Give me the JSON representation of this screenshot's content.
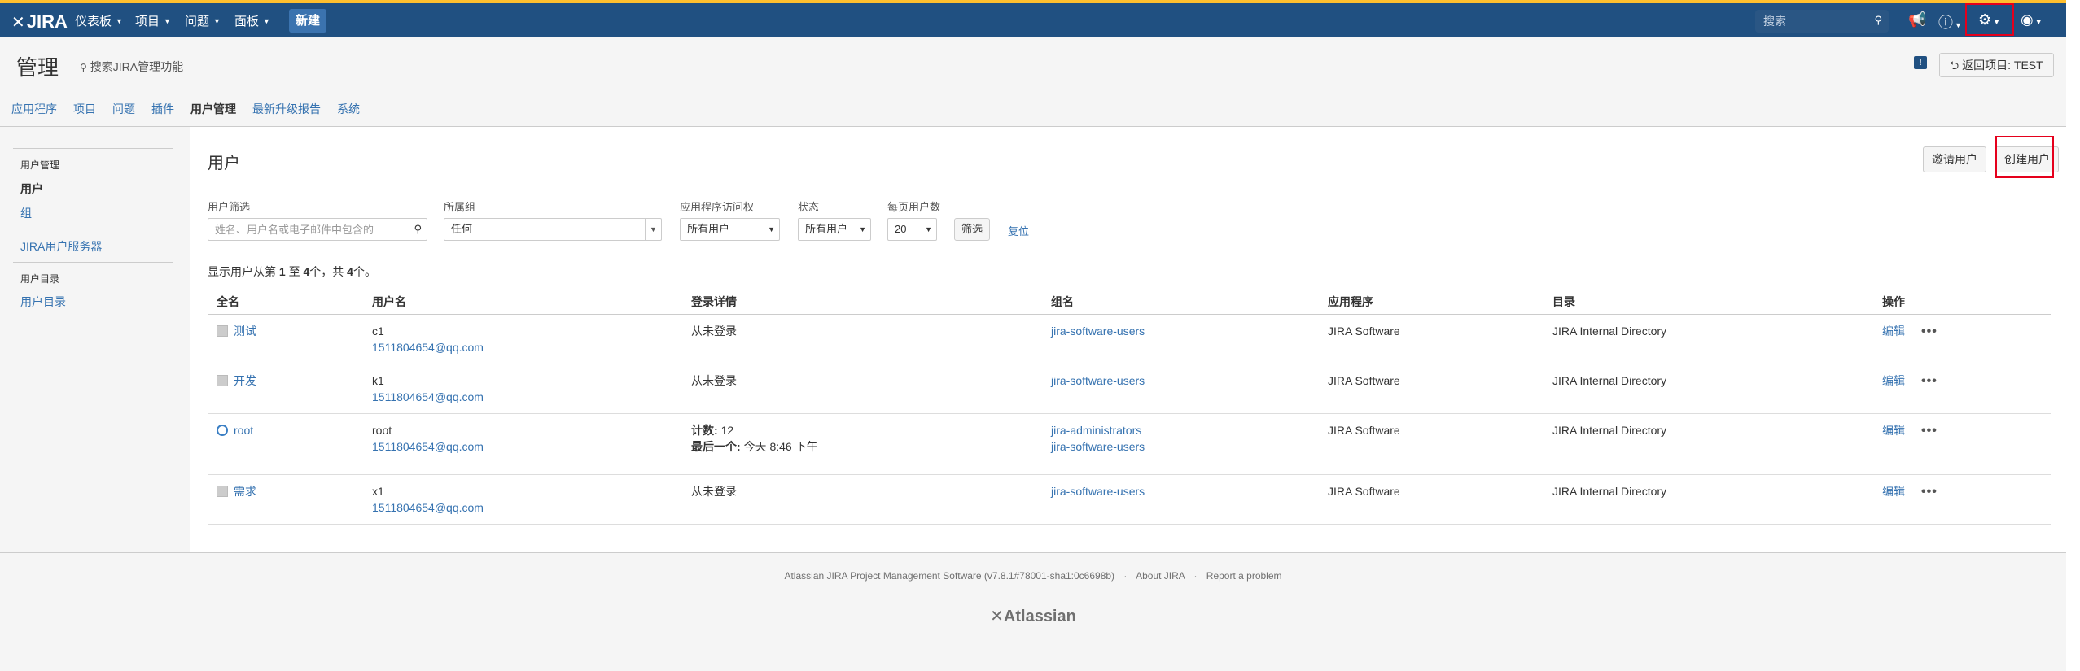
{
  "topbar": {
    "logo_text": "JIRA",
    "menus": [
      {
        "label": "仪表板"
      },
      {
        "label": "项目"
      },
      {
        "label": "问题"
      },
      {
        "label": "面板"
      }
    ],
    "create_label": "新建",
    "search_placeholder": "搜索"
  },
  "admin_header": {
    "title": "管理",
    "search_label": "搜索JIRA管理功能",
    "return_label": "返回项目: TEST"
  },
  "admin_tabs": [
    {
      "label": "应用程序"
    },
    {
      "label": "项目"
    },
    {
      "label": "问题"
    },
    {
      "label": "插件"
    },
    {
      "label": "用户管理"
    },
    {
      "label": "最新升级报告"
    },
    {
      "label": "系统"
    }
  ],
  "sidebar": {
    "group1_title": "用户管理",
    "item_users": "用户",
    "item_groups": "组",
    "item_jira_user_server": "JIRA用户服务器",
    "group2_title": "用户目录",
    "item_user_directories": "用户目录"
  },
  "content": {
    "title": "用户",
    "invite_label": "邀请用户",
    "create_user_label": "创建用户",
    "filters": {
      "user_filter_label": "用户筛选",
      "user_filter_placeholder": "姓名、用户名或电子邮件中包含的",
      "group_label": "所属组",
      "group_value": "任何",
      "app_access_label": "应用程序访问权",
      "app_access_value": "所有用户",
      "status_label": "状态",
      "status_value": "所有用户",
      "per_page_label": "每页用户数",
      "per_page_value": "20",
      "filter_button": "筛选",
      "reset_link": "复位"
    },
    "summary": {
      "prefix": "显示用户从第",
      "from": "1",
      "mid1": "至",
      "to": "4",
      "mid2": "个，共",
      "total": "4",
      "suffix": "个。"
    },
    "table": {
      "headers": [
        "全名",
        "用户名",
        "登录详情",
        "组名",
        "应用程序",
        "目录",
        "操作"
      ],
      "rows": [
        {
          "fullname": "测试",
          "username": "c1",
          "email": "1511804654@qq.com",
          "login": "从未登录",
          "groups": [
            "jira-software-users"
          ],
          "app": "JIRA Software",
          "directory": "JIRA Internal Directory",
          "edit": "编辑"
        },
        {
          "fullname": "开发",
          "username": "k1",
          "email": "1511804654@qq.com",
          "login": "从未登录",
          "groups": [
            "jira-software-users"
          ],
          "app": "JIRA Software",
          "directory": "JIRA Internal Directory",
          "edit": "编辑"
        },
        {
          "fullname": "root",
          "username": "root",
          "email": "1511804654@qq.com",
          "login_count_label": "计数:",
          "login_count": "12",
          "login_last_label": "最后一个:",
          "login_last": "今天 8:46 下午",
          "groups": [
            "jira-administrators",
            "jira-software-users"
          ],
          "app": "JIRA Software",
          "directory": "JIRA Internal Directory",
          "edit": "编辑"
        },
        {
          "fullname": "需求",
          "username": "x1",
          "email": "1511804654@qq.com",
          "login": "从未登录",
          "groups": [
            "jira-software-users"
          ],
          "app": "JIRA Software",
          "directory": "JIRA Internal Directory",
          "edit": "编辑"
        }
      ]
    }
  },
  "footer": {
    "version": "Atlassian JIRA Project Management Software (v7.8.1#78001-sha1:0c6698b)",
    "about": "About JIRA",
    "report": "Report a problem",
    "logo": "Atlassian"
  }
}
